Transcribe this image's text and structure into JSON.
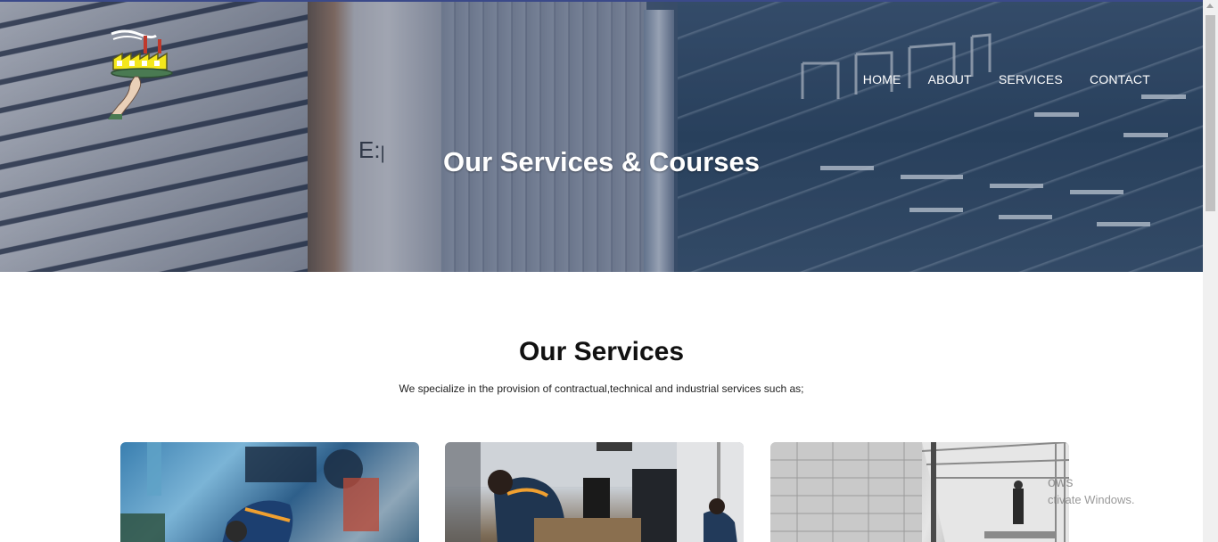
{
  "nav": {
    "items": [
      {
        "label": "HOME"
      },
      {
        "label": "ABOUT"
      },
      {
        "label": "SERVICES"
      },
      {
        "label": "CONTACT"
      }
    ]
  },
  "hero": {
    "title": "Our Services & Courses"
  },
  "services": {
    "title": "Our Services",
    "subtitle": "We specialize in the provision of contractual,technical and industrial services such as;"
  },
  "watermark": {
    "line1": "ows",
    "line2": "ctivate Windows."
  }
}
